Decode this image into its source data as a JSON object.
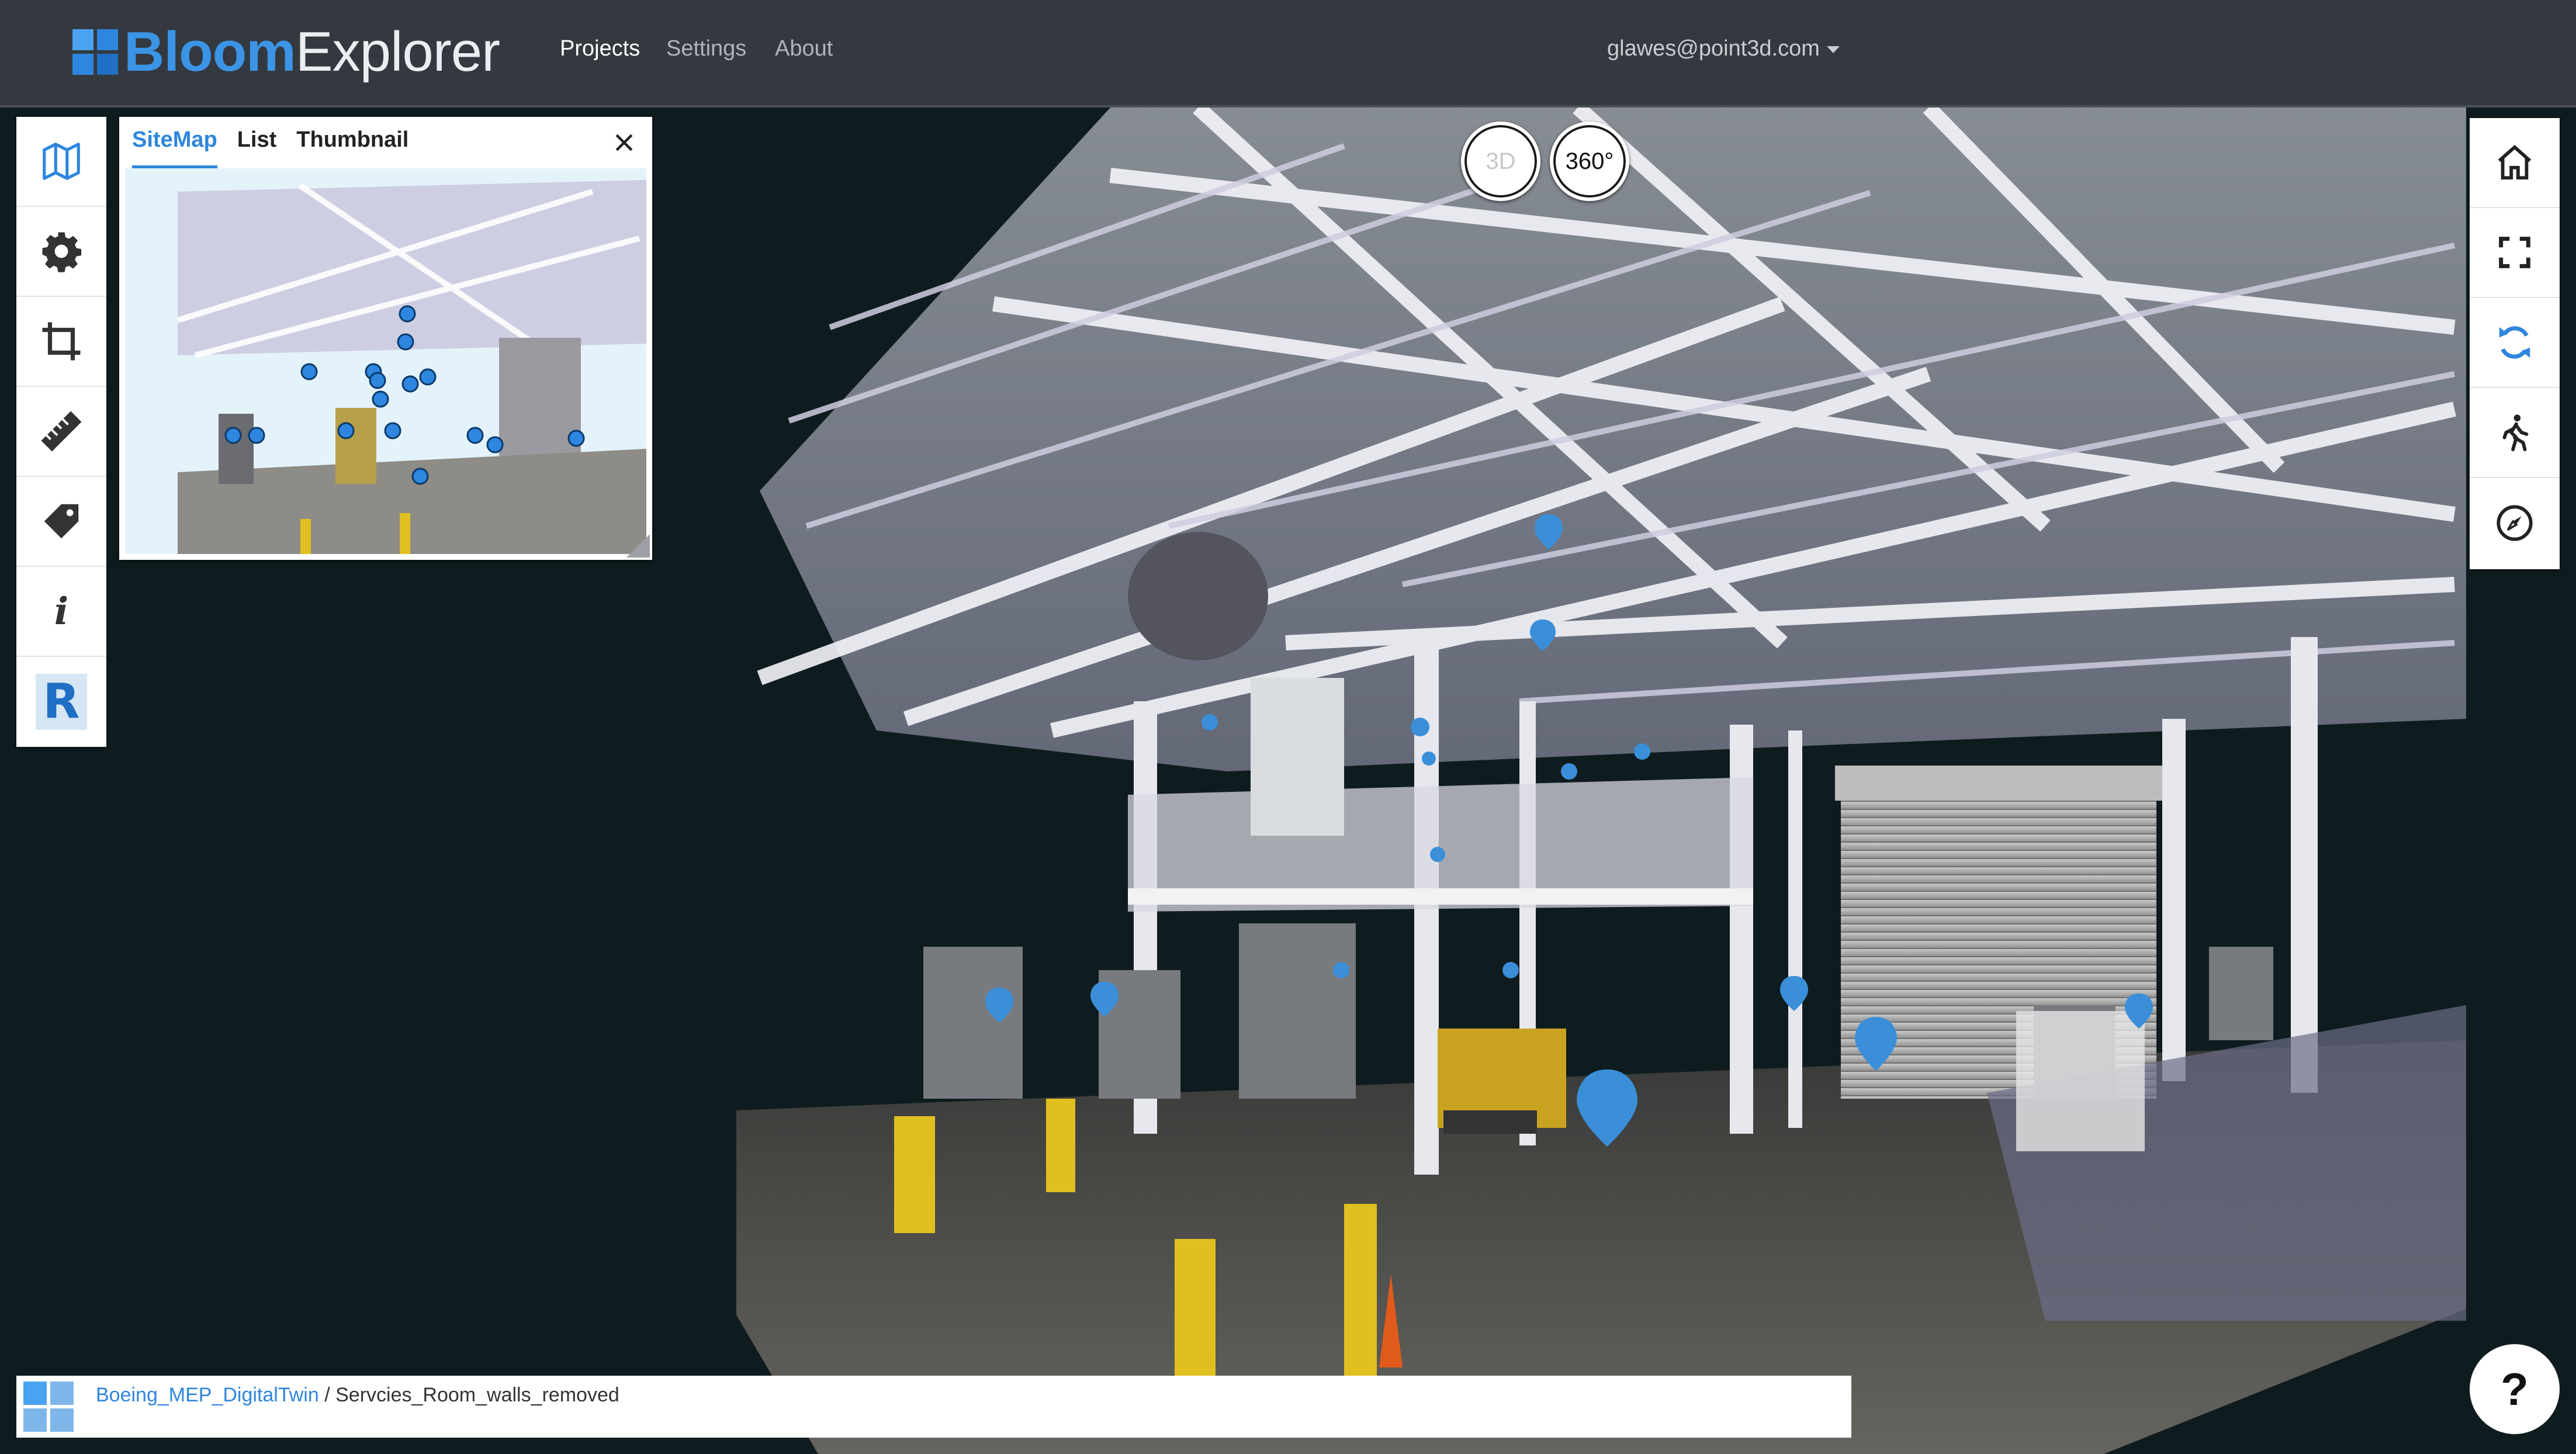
{
  "app": {
    "brand_bold": "Bloom",
    "brand_light": "Explorer"
  },
  "nav": {
    "links": [
      "Projects",
      "Settings",
      "About"
    ],
    "active": "Projects",
    "user": "glawes@point3d.com"
  },
  "left_toolbar": {
    "tools": [
      {
        "name": "map-icon",
        "active": true
      },
      {
        "name": "gear-icon",
        "active": false
      },
      {
        "name": "crop-icon",
        "active": false
      },
      {
        "name": "ruler-icon",
        "active": false
      },
      {
        "name": "tag-icon",
        "active": false
      },
      {
        "name": "info-icon",
        "active": false
      },
      {
        "name": "revit-icon",
        "active": false
      }
    ],
    "info_glyph": "i",
    "revit_glyph": "R"
  },
  "sitemap": {
    "tabs": [
      "SiteMap",
      "List",
      "Thumbnail"
    ],
    "active_tab": "SiteMap"
  },
  "view_modes": {
    "mode_3d": "3D",
    "mode_360": "360°",
    "active": "360°"
  },
  "right_toolbar": {
    "tools": [
      "home-icon",
      "fullscreen-icon",
      "sync-icon",
      "walk-icon",
      "compass-icon"
    ],
    "active": "sync-icon"
  },
  "breadcrumb": {
    "project": "Boeing_MEP_DigitalTwin",
    "separator": "/",
    "scene": "Servcies_Room_walls_removed"
  },
  "help": {
    "label": "?"
  },
  "colors": {
    "accent": "#2e86de",
    "navbar": "#33393f",
    "scene_background": "#0f1c1f",
    "marker": "#3b8fd9"
  }
}
